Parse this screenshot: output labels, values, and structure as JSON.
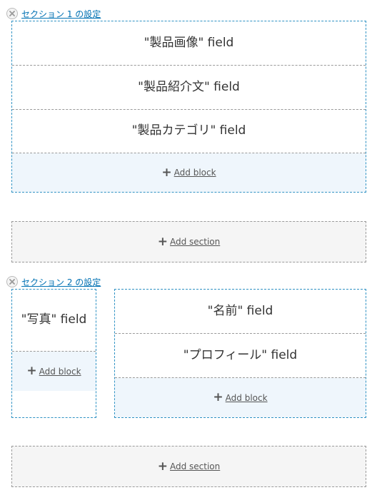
{
  "section1": {
    "config_link": "セクション 1 の設定",
    "fields": [
      "\"製品画像\" field",
      "\"製品紹介文\" field",
      "\"製品カテゴリ\" field"
    ],
    "add_block_label": "Add block"
  },
  "add_section_1": {
    "label": "Add section"
  },
  "section2": {
    "config_link": "セクション 2 の設定",
    "first_region": {
      "fields": [
        "\"写真\" field"
      ],
      "add_block_label": "Add block"
    },
    "second_region": {
      "fields": [
        "\"名前\" field",
        "\"プロフィール\" field"
      ],
      "add_block_label": "Add block"
    }
  },
  "add_section_2": {
    "label": "Add section"
  },
  "icons": {
    "close": "close-icon",
    "plus": "plus-icon"
  },
  "colors": {
    "link": "#0071b3",
    "region_border": "#2f92c4",
    "add_block_bg": "#eff6fc",
    "add_section_bg": "#f5f5f5"
  }
}
